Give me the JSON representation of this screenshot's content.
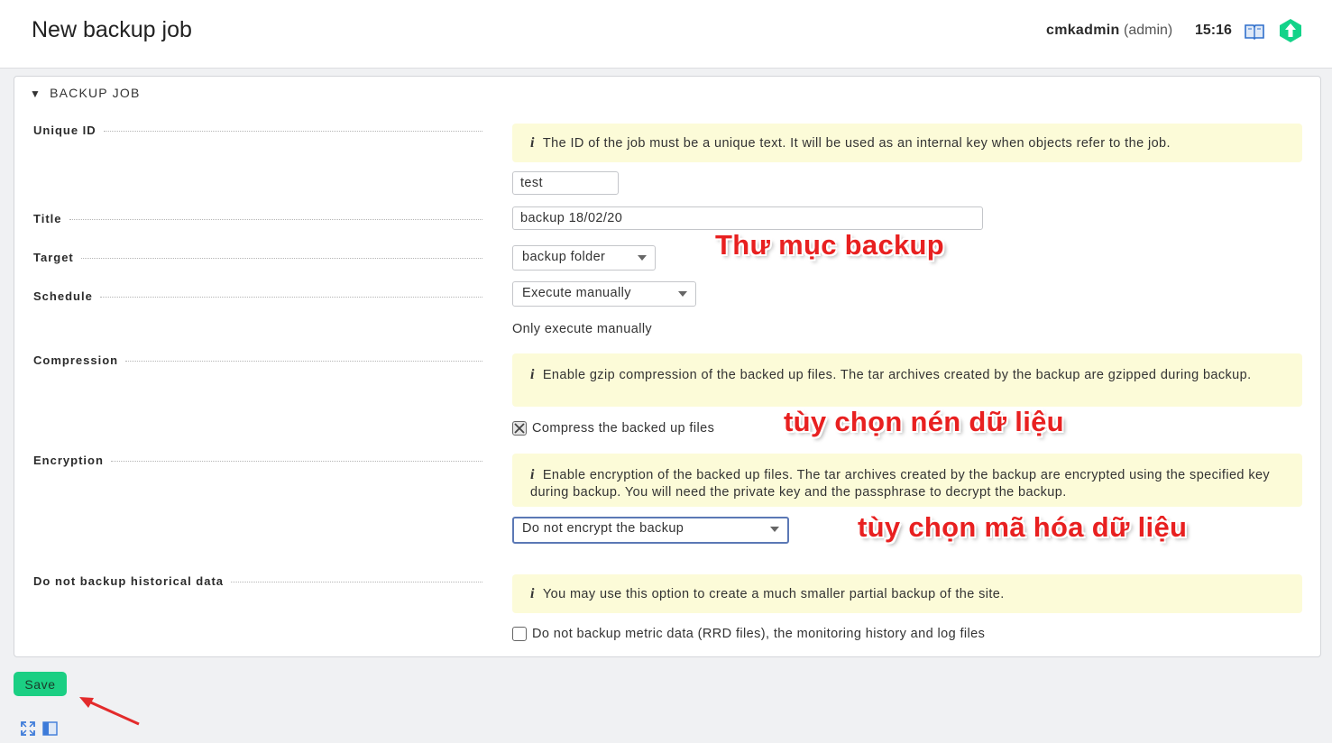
{
  "header": {
    "title": "New backup job",
    "username": "cmkadmin",
    "role": "(admin)",
    "time": "15:16",
    "icons": [
      "help-book-icon",
      "checkmk-logo-icon"
    ]
  },
  "section": {
    "title": "BACKUP JOB",
    "toggle_icon": "triangle-down-icon"
  },
  "fields": {
    "unique_id": {
      "label": "Unique ID",
      "help": "The ID of the job must be a unique text. It will be used as an internal key when objects refer to the job.",
      "value": "test"
    },
    "title": {
      "label": "Title",
      "value": "backup 18/02/20"
    },
    "target": {
      "label": "Target",
      "selected": "backup folder"
    },
    "schedule": {
      "label": "Schedule",
      "selected": "Execute manually",
      "note": "Only execute manually"
    },
    "compression": {
      "label": "Compression",
      "help": "Enable gzip compression of the backed up files. The tar archives created by the backup are gzipped during backup.",
      "checkbox_label": "Compress the backed up files",
      "checked": true
    },
    "encryption": {
      "label": "Encryption",
      "help": "Enable encryption of the backed up files. The tar archives created by the backup are encrypted using the specified key during backup. You will need the private key and the passphrase to decrypt the backup.",
      "selected": "Do not encrypt the backup"
    },
    "no_history": {
      "label": "Do not backup historical data",
      "help": "You may use this option to create a much smaller partial backup of the site.",
      "checkbox_label": "Do not backup metric data (RRD files), the monitoring history and log files",
      "checked": false
    }
  },
  "annotations": {
    "target_note": "Thư mục backup",
    "compression_note": "tùy chọn nén dữ liệu",
    "encryption_note": "tùy chọn mã hóa dữ liệu"
  },
  "footer": {
    "save_label": "Save",
    "icons": [
      "fullscreen-icon",
      "sidebar-icon"
    ]
  },
  "colors": {
    "save_button": "#1bcf83",
    "help_background": "#fcfbd8",
    "annotation_text": "#e82020",
    "logo": "#13d389"
  }
}
